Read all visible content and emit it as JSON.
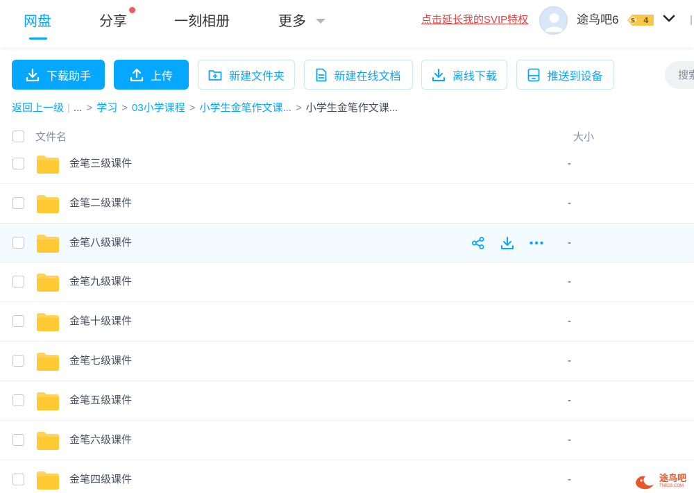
{
  "nav": {
    "tabs": [
      {
        "label": "网盘",
        "active": true
      },
      {
        "label": "分享",
        "active": false
      },
      {
        "label": "一刻相册",
        "active": false
      },
      {
        "label": "更多",
        "active": false
      }
    ],
    "svip_link": "点击延长我的SVIP特权",
    "username": "途鸟吧6",
    "badge_s": "S",
    "badge_level": "4"
  },
  "toolbar": {
    "download_helper": "下载助手",
    "upload": "上传",
    "new_folder": "新建文件夹",
    "new_online_doc": "新建在线文档",
    "offline_download": "离线下载",
    "push_to_device": "推送到设备",
    "search_placeholder": "搜索"
  },
  "breadcrumb": {
    "back": "返回上一级",
    "ellipsis": "...",
    "items": [
      "学习",
      "03小学课程",
      "小学生金笔作文课..."
    ],
    "current": "小学生金笔作文课..."
  },
  "table": {
    "col_name": "文件名",
    "col_size": "大小",
    "rows": [
      {
        "name": "金笔三级课件",
        "size": "-"
      },
      {
        "name": "金笔二级课件",
        "size": "-"
      },
      {
        "name": "金笔八级课件",
        "size": "-"
      },
      {
        "name": "金笔九级课件",
        "size": "-"
      },
      {
        "name": "金笔十级课件",
        "size": "-"
      },
      {
        "name": "金笔七级课件",
        "size": "-"
      },
      {
        "name": "金笔五级课件",
        "size": "-"
      },
      {
        "name": "金笔六级课件",
        "size": "-"
      },
      {
        "name": "金笔四级课件",
        "size": "-"
      }
    ]
  },
  "watermark": {
    "text": "途鸟吧",
    "sub": "TNB2S.COM"
  },
  "colors": {
    "accent": "#06a7ff",
    "folder": "#ffd258",
    "svip": "#e33e3e"
  }
}
